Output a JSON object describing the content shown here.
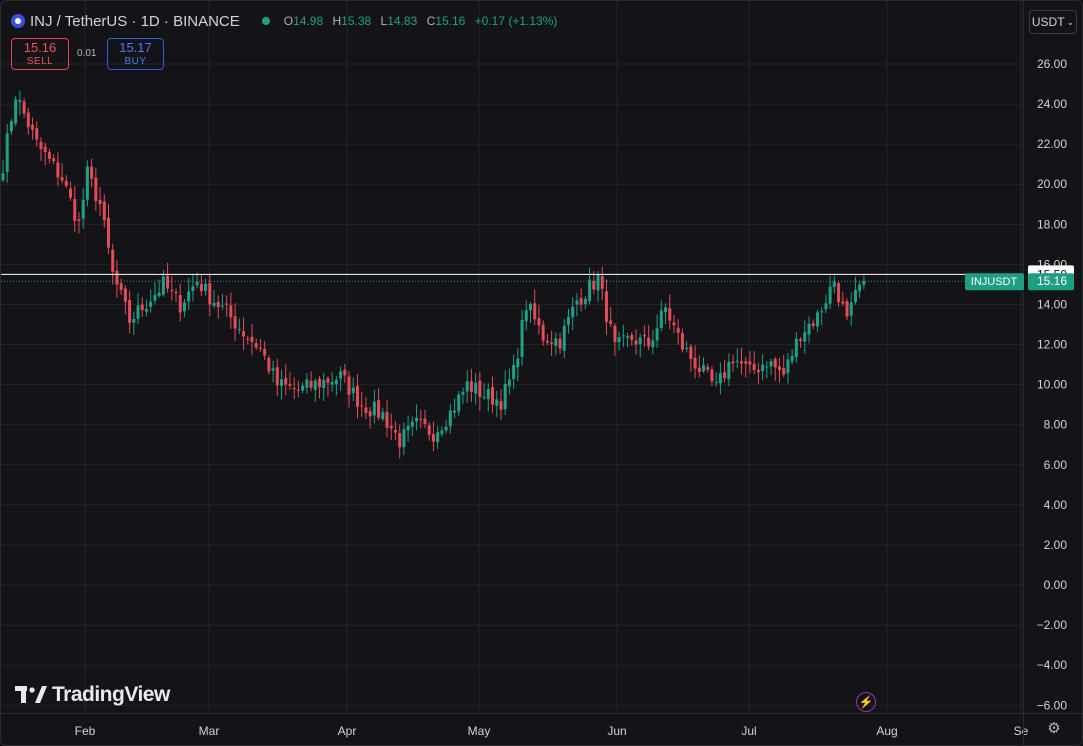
{
  "header": {
    "symbol_title": "INJ / TetherUS · 1D · BINANCE",
    "ohlc": {
      "o_label": "O",
      "o": "14.98",
      "h_label": "H",
      "h": "15.38",
      "l_label": "L",
      "l": "14.83",
      "c_label": "C",
      "c": "15.16",
      "change": "+0.17 (+1.13%)"
    },
    "status_color": "#1fa186"
  },
  "trade_panel": {
    "sell_price": "15.16",
    "sell_label": "SELL",
    "spread": "0.01",
    "buy_price": "15.17",
    "buy_label": "BUY"
  },
  "currency_selector": "USDT",
  "brand": "TradingView",
  "colors": {
    "up": "#1fa186",
    "down": "#e34c58",
    "background": "#131318",
    "grid": "#23242b",
    "price_line": "#ffffff",
    "last_price_tag": "#1e9f84"
  },
  "icons": [
    "lightning-icon",
    "gear-icon",
    "chevron-down-icon",
    "tradingview-logo-icon"
  ],
  "chart_data": {
    "type": "candlestick",
    "symbol": "INJUSDT",
    "interval": "1D",
    "x_labels": [
      "Feb",
      "Mar",
      "Apr",
      "May",
      "Jun",
      "Jul",
      "Aug",
      "Se"
    ],
    "y_ticks": [
      "26.00",
      "24.00",
      "22.00",
      "20.00",
      "18.00",
      "16.00",
      "14.00",
      "12.00",
      "10.00",
      "8.00",
      "6.00",
      "4.00",
      "2.00",
      "0.00",
      "−2.00",
      "−4.00",
      "−6.00"
    ],
    "ylim": [
      -6.5,
      27.5
    ],
    "price_line": {
      "value": 15.5,
      "label": "15.50"
    },
    "last_price": {
      "value": 15.16,
      "label": "15.16",
      "symbol_label": "INJUSDT"
    },
    "grid": true,
    "days": 205,
    "close_series": [
      [
        0,
        21.0
      ],
      [
        3,
        24.5
      ],
      [
        8,
        22.0
      ],
      [
        14,
        20.3
      ],
      [
        18,
        18.0
      ],
      [
        20,
        20.5
      ],
      [
        23,
        19.0
      ],
      [
        26,
        15.5
      ],
      [
        30,
        13.2
      ],
      [
        34,
        14.1
      ],
      [
        38,
        15.0
      ],
      [
        42,
        14.0
      ],
      [
        46,
        15.2
      ],
      [
        49,
        14.4
      ],
      [
        53,
        13.6
      ],
      [
        57,
        12.6
      ],
      [
        61,
        11.8
      ],
      [
        65,
        10.0
      ],
      [
        70,
        9.7
      ],
      [
        75,
        10.1
      ],
      [
        80,
        10.4
      ],
      [
        85,
        9.0
      ],
      [
        90,
        8.5
      ],
      [
        94,
        7.2
      ],
      [
        98,
        8.0
      ],
      [
        102,
        7.6
      ],
      [
        106,
        8.6
      ],
      [
        110,
        10.0
      ],
      [
        114,
        9.5
      ],
      [
        118,
        9.2
      ],
      [
        121,
        10.6
      ],
      [
        124,
        14.0
      ],
      [
        128,
        12.4
      ],
      [
        132,
        12.2
      ],
      [
        136,
        14.2
      ],
      [
        141,
        15.3
      ],
      [
        145,
        11.8
      ],
      [
        149,
        12.3
      ],
      [
        153,
        12.0
      ],
      [
        157,
        13.8
      ],
      [
        161,
        11.9
      ],
      [
        165,
        10.8
      ],
      [
        169,
        9.8
      ],
      [
        173,
        11.4
      ],
      [
        177,
        10.6
      ],
      [
        181,
        11.2
      ],
      [
        185,
        10.5
      ],
      [
        189,
        12.6
      ],
      [
        193,
        13.4
      ],
      [
        197,
        15.2
      ],
      [
        200,
        13.1
      ],
      [
        203,
        14.98
      ],
      [
        204,
        15.16
      ]
    ]
  }
}
